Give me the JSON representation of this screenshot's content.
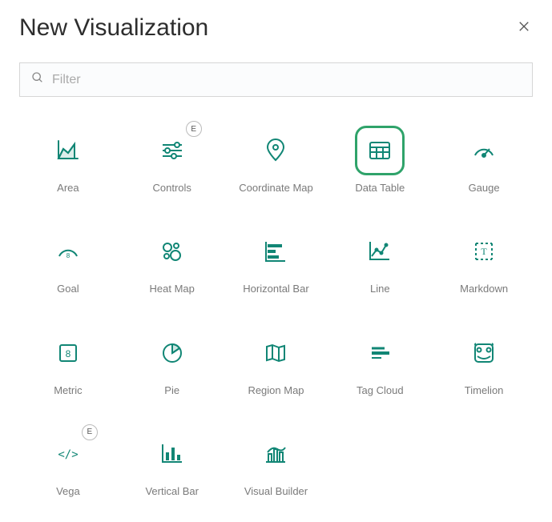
{
  "title": "New Visualization",
  "filter_placeholder": "Filter",
  "badge_label": "E",
  "items": [
    {
      "id": "area",
      "label": "Area",
      "selected": false,
      "badge": false
    },
    {
      "id": "controls",
      "label": "Controls",
      "selected": false,
      "badge": true
    },
    {
      "id": "coordinate-map",
      "label": "Coordinate Map",
      "selected": false,
      "badge": false
    },
    {
      "id": "data-table",
      "label": "Data Table",
      "selected": true,
      "badge": false
    },
    {
      "id": "gauge",
      "label": "Gauge",
      "selected": false,
      "badge": false
    },
    {
      "id": "goal",
      "label": "Goal",
      "selected": false,
      "badge": false
    },
    {
      "id": "heat-map",
      "label": "Heat Map",
      "selected": false,
      "badge": false
    },
    {
      "id": "horizontal-bar",
      "label": "Horizontal Bar",
      "selected": false,
      "badge": false
    },
    {
      "id": "line",
      "label": "Line",
      "selected": false,
      "badge": false
    },
    {
      "id": "markdown",
      "label": "Markdown",
      "selected": false,
      "badge": false
    },
    {
      "id": "metric",
      "label": "Metric",
      "selected": false,
      "badge": false
    },
    {
      "id": "pie",
      "label": "Pie",
      "selected": false,
      "badge": false
    },
    {
      "id": "region-map",
      "label": "Region Map",
      "selected": false,
      "badge": false
    },
    {
      "id": "tag-cloud",
      "label": "Tag Cloud",
      "selected": false,
      "badge": false
    },
    {
      "id": "timelion",
      "label": "Timelion",
      "selected": false,
      "badge": false
    },
    {
      "id": "vega",
      "label": "Vega",
      "selected": false,
      "badge": true
    },
    {
      "id": "vertical-bar",
      "label": "Vertical Bar",
      "selected": false,
      "badge": false
    },
    {
      "id": "visual-builder",
      "label": "Visual Builder",
      "selected": false,
      "badge": false
    }
  ]
}
